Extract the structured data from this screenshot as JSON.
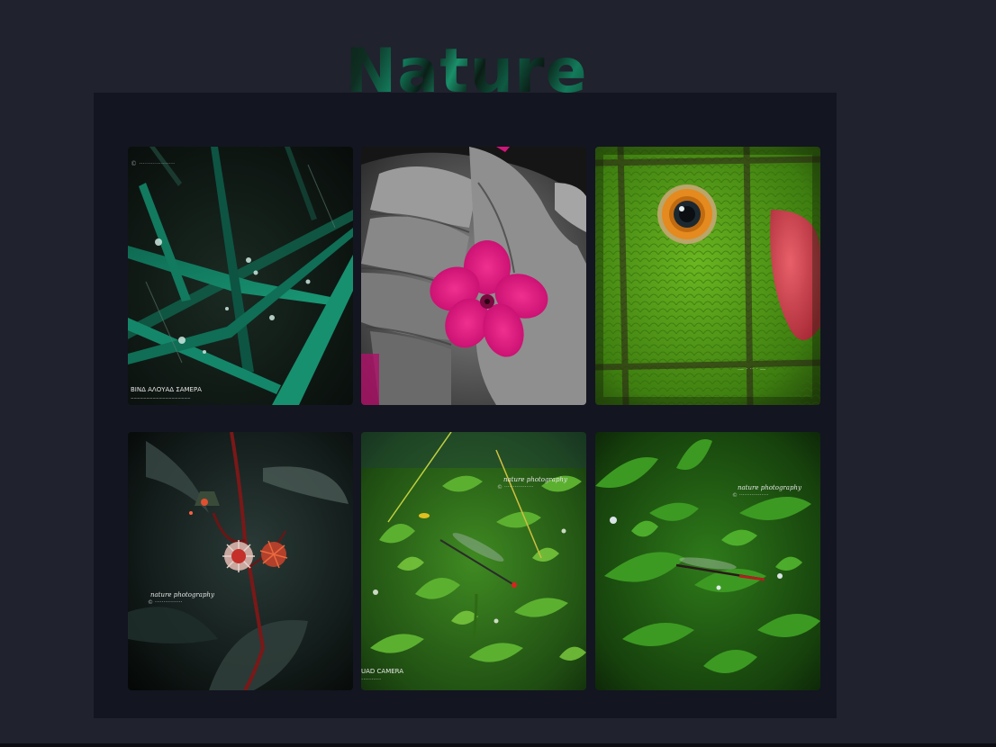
{
  "header": {
    "title": "Nature"
  },
  "gallery": {
    "photos": [
      {
        "subject": "grass blades with water drops",
        "watermark_top": "© ··················",
        "watermark_line1": "ΒΙΝΔ ΑΛΟΥΑΔ ΣΑΜΕΡΑ",
        "watermark_line2": "–––––––––––––––––––"
      },
      {
        "subject": "pink flower in hand"
      },
      {
        "subject": "green parrot eye close-up"
      },
      {
        "subject": "thistle flowers on red stem",
        "watermark_script": "nature photography",
        "watermark_sub": "© ················"
      },
      {
        "subject": "damselfly among green plants",
        "watermark_script": "nature photography",
        "watermark_sub": "© ·················",
        "watermark_line1": "UAD CAMERA",
        "watermark_line2": "··········"
      },
      {
        "subject": "damselfly on green leaves",
        "watermark_script": "nature photography",
        "watermark_sub": "© ·················"
      }
    ]
  },
  "colors": {
    "page_background": "#20222e",
    "gallery_background": "#131520",
    "title_accent": "#127a5a"
  }
}
